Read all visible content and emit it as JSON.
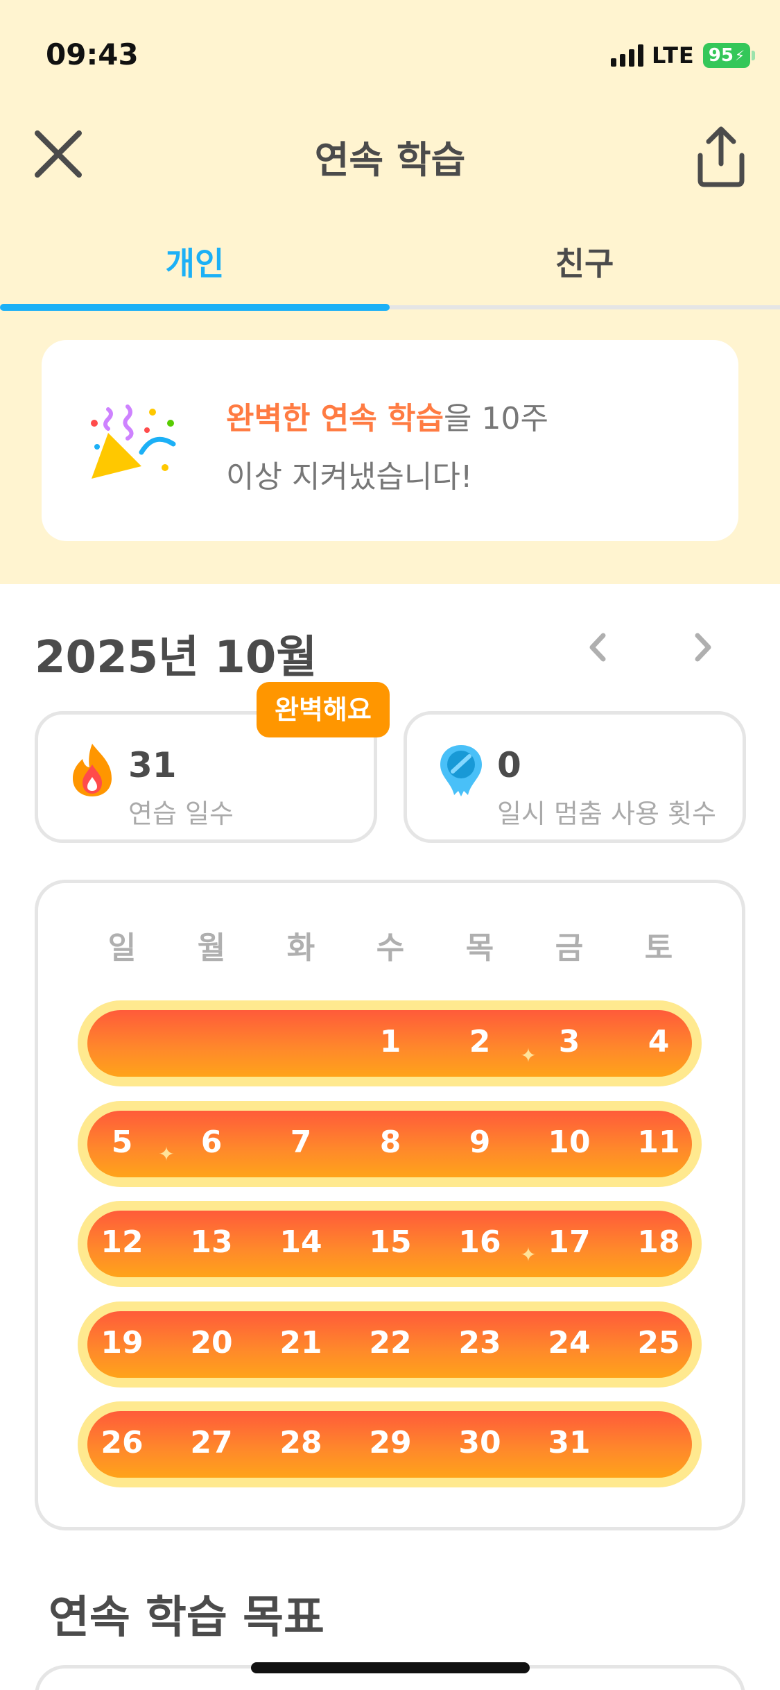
{
  "status": {
    "time": "09:43",
    "network": "LTE",
    "battery": "95"
  },
  "header": {
    "title": "연속 학습"
  },
  "tabs": [
    {
      "label": "개인",
      "active": true
    },
    {
      "label": "친구",
      "active": false
    }
  ],
  "banner": {
    "highlight": "완벽한 연속 학습",
    "rest1": "을 10주",
    "rest2": "이상 지켜냈습니다!",
    "icon": "party-popper-icon"
  },
  "month": {
    "title": "2025년 10월"
  },
  "stats": {
    "practice": {
      "value": "31",
      "label": "연습 일수",
      "badge": "완벽해요",
      "icon": "flame-icon"
    },
    "freeze": {
      "value": "0",
      "label": "일시 멈춤 사용 횟수",
      "icon": "streak-freeze-icon"
    }
  },
  "calendar": {
    "weekdays": [
      "일",
      "월",
      "화",
      "수",
      "목",
      "금",
      "토"
    ],
    "weeks": [
      [
        "",
        "",
        "",
        "1",
        "2",
        "3",
        "4"
      ],
      [
        "5",
        "6",
        "7",
        "8",
        "9",
        "10",
        "11"
      ],
      [
        "12",
        "13",
        "14",
        "15",
        "16",
        "17",
        "18"
      ],
      [
        "19",
        "20",
        "21",
        "22",
        "23",
        "24",
        "25"
      ],
      [
        "26",
        "27",
        "28",
        "29",
        "30",
        "31",
        ""
      ]
    ]
  },
  "goal": {
    "title": "연속 학습 목표"
  },
  "colors": {
    "accent_blue": "#1cb0f6",
    "banner_highlight": "#ff7b42",
    "badge": "#ff9600",
    "background_top": "#fff4d0"
  }
}
